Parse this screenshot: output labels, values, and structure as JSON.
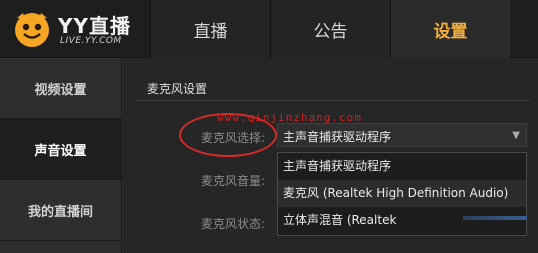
{
  "app": {
    "logo_title": "YY直播",
    "logo_url": "LIVE.YY.COM"
  },
  "nav": {
    "tabs": [
      {
        "label": "直播",
        "active": false
      },
      {
        "label": "公告",
        "active": false
      },
      {
        "label": "设置",
        "active": true
      }
    ]
  },
  "sidebar": {
    "items": [
      {
        "label": "视频设置",
        "active": false
      },
      {
        "label": "声音设置",
        "active": true
      },
      {
        "label": "我的直播间",
        "active": false
      }
    ]
  },
  "content": {
    "section_title": "麦克风设置",
    "watermark": "www.qinjinzhang.com",
    "mic_select_label": "麦克风选择:",
    "mic_volume_label": "麦克风音量:",
    "mic_status_label": "麦克风状态:",
    "mic_select_value": "主声音捕获驱动程序",
    "mic_options": [
      "主声音捕获驱动程序",
      "麦克风 (Realtek High Definition Audio)",
      "立体声混音 (Realtek"
    ]
  },
  "colors": {
    "accent": "#f0b040",
    "annotation": "#d42a2a"
  },
  "icons": {
    "logo": "yy-logo-icon",
    "dropdown": "chevron-down-icon"
  }
}
